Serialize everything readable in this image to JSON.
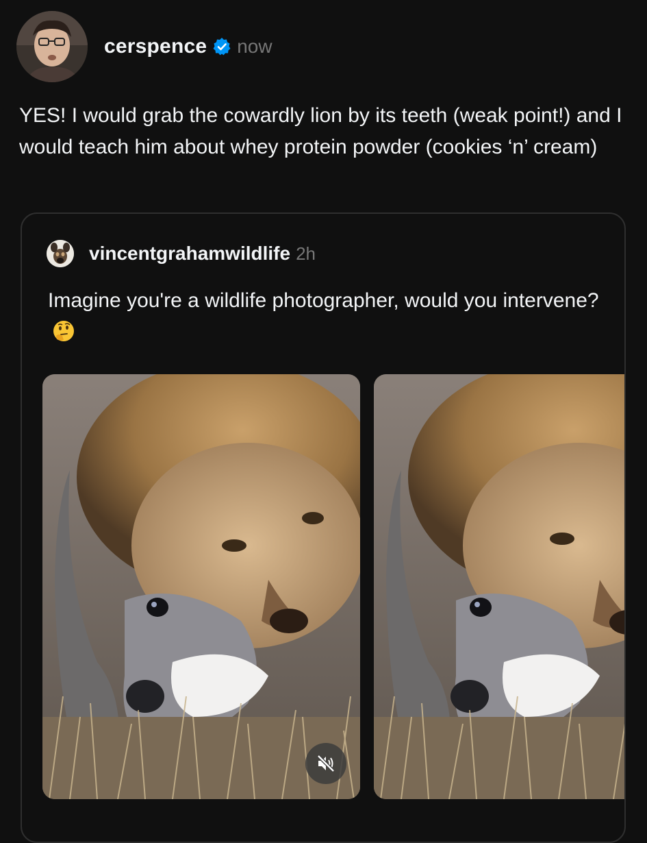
{
  "post": {
    "username": "cerspence",
    "timestamp": "now",
    "verified": true,
    "avatar_icon": "profile-photo",
    "text": "YES! I would grab the cowardly lion by its teeth (weak point!) and I would teach him about whey protein powder (cookies ‘n’ cream)"
  },
  "quoted_post": {
    "username": "vincentgrahamwildlife",
    "timestamp": "2h",
    "avatar_icon": "wild-dog-photo",
    "text": "Imagine you're a wildlife photographer, would you intervene?",
    "emoji": "thinking-face-emoji",
    "media": [
      {
        "kind": "video",
        "subject": "lion-with-kudu-photo",
        "muted": true
      },
      {
        "kind": "image",
        "subject": "lion-with-kudu-photo"
      }
    ]
  },
  "colors": {
    "background": "#101010",
    "text_primary": "#f3f5f7",
    "text_secondary": "#777777",
    "verified_blue": "#0095f6",
    "card_border": "#2f2f2f"
  }
}
